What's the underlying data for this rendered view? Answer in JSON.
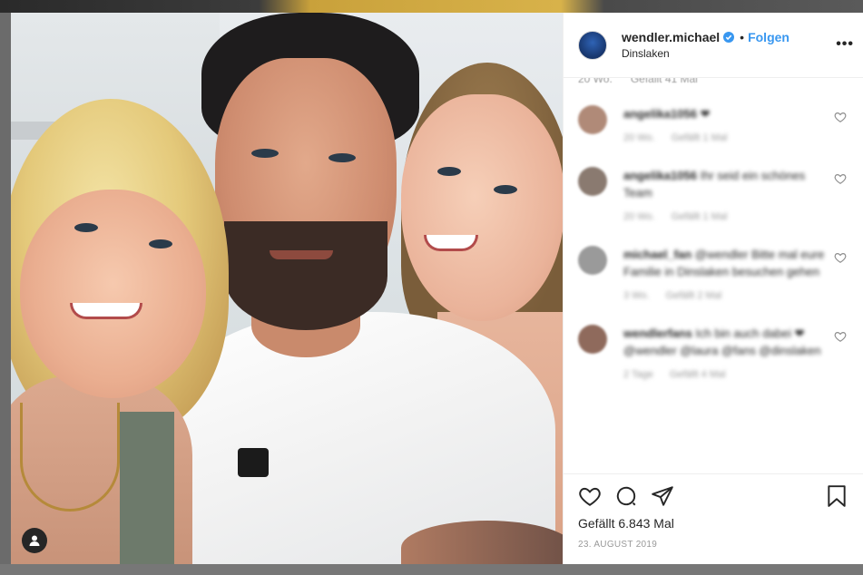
{
  "post": {
    "username": "wendler.michael",
    "separator": "•",
    "follow_label": "Folgen",
    "location": "Dinslaken",
    "more_label": "•••",
    "caption_age": "20 Wo.",
    "caption_likes": "Gefällt 41 Mal",
    "likes_text": "Gefällt 6.843 Mal",
    "date": "23. AUGUST 2019"
  },
  "comments": [
    {
      "user": "angelika1056",
      "text": "❤",
      "age": "20 Wo.",
      "likes": "Gefällt 1 Mal",
      "avatar_color": "#b08a78"
    },
    {
      "user": "angelika1056",
      "text": "Ihr seid ein schönes Team",
      "age": "20 Wo.",
      "likes": "Gefällt 1 Mal",
      "avatar_color": "#8a7a70"
    },
    {
      "user": "michael_fan",
      "text": "@wendler Bitte mal eure Familie in Dinslaken besuchen gehen",
      "age": "3 Wo.",
      "likes": "Gefällt 2 Mal",
      "avatar_color": "#9a9a9a"
    },
    {
      "user": "wendlerfans",
      "text": "Ich bin auch dabei ❤ @wendler @laura @fans @dinslaken",
      "age": "2 Tage",
      "likes": "Gefällt 4 Mal",
      "avatar_color": "#8f6a5c"
    }
  ],
  "colors": {
    "accent": "#3897f0",
    "verified": "#3897f0",
    "text": "#262626",
    "muted": "#999999"
  },
  "icons": [
    "verified-icon",
    "heart-icon",
    "comment-icon",
    "share-icon",
    "bookmark-icon",
    "user-icon"
  ]
}
